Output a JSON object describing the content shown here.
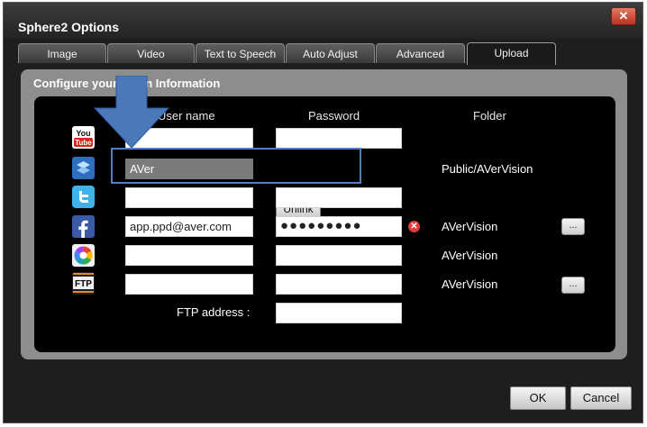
{
  "window": {
    "title": "Sphere2 Options",
    "close_glyph": "✕"
  },
  "tabs": [
    {
      "label": "Image"
    },
    {
      "label": "Video"
    },
    {
      "label": "Text to Speech"
    },
    {
      "label": "Auto Adjust"
    },
    {
      "label": "Advanced"
    },
    {
      "label": "Upload",
      "active": true
    }
  ],
  "section": {
    "title": "Configure your Login Information",
    "col_username": "User name",
    "col_password": "Password",
    "col_folder": "Folder"
  },
  "services": [
    {
      "icon": "youtube-icon",
      "username": "",
      "password": "",
      "folder": ""
    },
    {
      "icon": "dropbox-icon",
      "username": "AVer",
      "unlink_label": "Unlink",
      "folder": "Public/AVerVision"
    },
    {
      "icon": "twitter-icon",
      "username": "",
      "password": "",
      "folder": ""
    },
    {
      "icon": "facebook-icon",
      "username": "app.ppd@aver.com",
      "password": "●●●●●●●●●",
      "folder": "AVerVision",
      "browse_label": "..."
    },
    {
      "icon": "picasa-icon",
      "username": "",
      "password": "",
      "folder": "AVerVision"
    },
    {
      "icon": "ftp-icon",
      "username": "",
      "password": "",
      "folder": "AVerVision",
      "browse_label": "..."
    }
  ],
  "ftp": {
    "address_label": "FTP address :",
    "address_value": ""
  },
  "buttons": {
    "ok": "OK",
    "cancel": "Cancel"
  },
  "colors": {
    "highlight_box": "#4f7fc0",
    "arrow": "#4a78b8",
    "window_bg": "#1e1e1e",
    "panel_gray": "#8d8d8d"
  }
}
